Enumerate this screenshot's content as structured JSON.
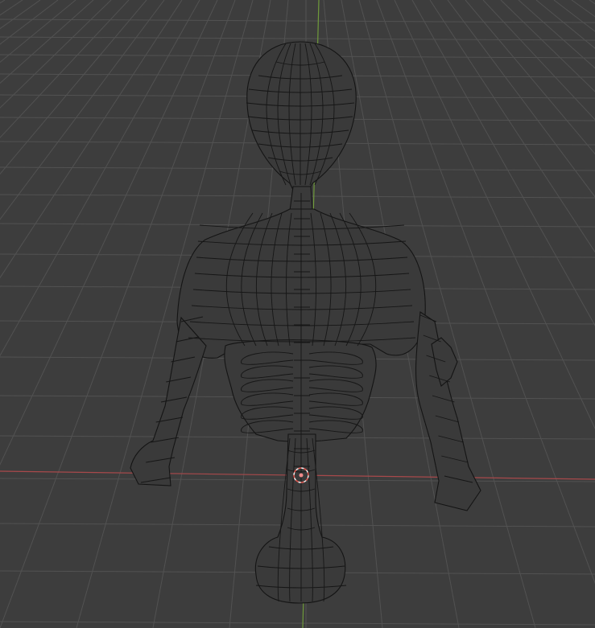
{
  "viewport": {
    "background": "#3d3d3d",
    "grid_color": "#545454",
    "x_axis_color": "#a24a4a",
    "z_axis_color": "#6a9a3a",
    "wire_color": "#1a1a1a",
    "origin_color": "#f08a8a"
  },
  "object": {
    "type": "mesh",
    "display": "wireframe",
    "description_icon": "skeleton-mesh"
  }
}
